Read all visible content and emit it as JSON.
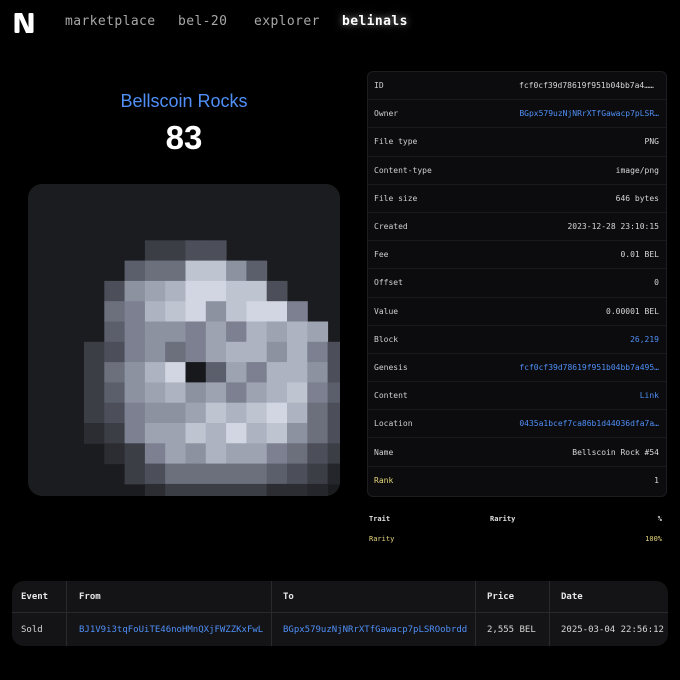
{
  "nav": {
    "logo_icon": "bells-logo-icon",
    "links": [
      "marketplace",
      "bel-20",
      "explorer",
      "belinals"
    ],
    "active": "belinals"
  },
  "inscription": {
    "collection": "Bellscoin Rocks",
    "number": "83"
  },
  "details": [
    {
      "label": "ID",
      "value": "fcf0cf39d78619f951b04bb7a4…",
      "link": false,
      "copy": true
    },
    {
      "label": "Owner",
      "value": "BGpx579uzNjNRrXTfGawacp7pLSR…",
      "link": true
    },
    {
      "label": "File type",
      "value": "PNG",
      "link": false
    },
    {
      "label": "Content-type",
      "value": "image/png",
      "link": false
    },
    {
      "label": "File size",
      "value": "646 bytes",
      "link": false
    },
    {
      "label": "Created",
      "value": "2023-12-28 23:10:15",
      "link": false
    },
    {
      "label": "Fee",
      "value": "0.01 BEL",
      "link": false
    },
    {
      "label": "Offset",
      "value": "0",
      "link": false
    },
    {
      "label": "Value",
      "value": "0.00001 BEL",
      "link": false
    },
    {
      "label": "Block",
      "value": "26,219",
      "link": true
    },
    {
      "label": "Genesis",
      "value": "fcf0cf39d78619f951b04bb7a495…",
      "link": true
    },
    {
      "label": "Content",
      "value": "Link",
      "link": true
    },
    {
      "label": "Location",
      "value": "0435a1bcef7ca86b1d44036dfa7a…",
      "link": true
    },
    {
      "label": "Name",
      "value": "Bellscoin Rock #54",
      "link": false
    },
    {
      "label": "Rank",
      "value": "1",
      "link": false,
      "highlight": true
    }
  ],
  "traits": {
    "headers": [
      "Trait",
      "Rarity",
      "%"
    ],
    "rows": [
      {
        "trait": "Rarity",
        "rarity": "",
        "pct": "100%"
      }
    ]
  },
  "activity": {
    "headers": [
      "Event",
      "From",
      "To",
      "Price",
      "Date"
    ],
    "rows": [
      {
        "event": "Sold",
        "from": "BJ1V9i3tqFoUiTE46noHMnQXjFWZZKxFwL",
        "to": "BGpx579uzNjNRrXTfGawacp7pLSROobrdd",
        "price": "2,555 BEL",
        "date": "2025-03-04 22:56:12"
      }
    ]
  },
  "colors": {
    "accent": "#4f8ff7",
    "highlight": "#e6d77a",
    "background": "#000000",
    "card": "#1b1c1f"
  }
}
